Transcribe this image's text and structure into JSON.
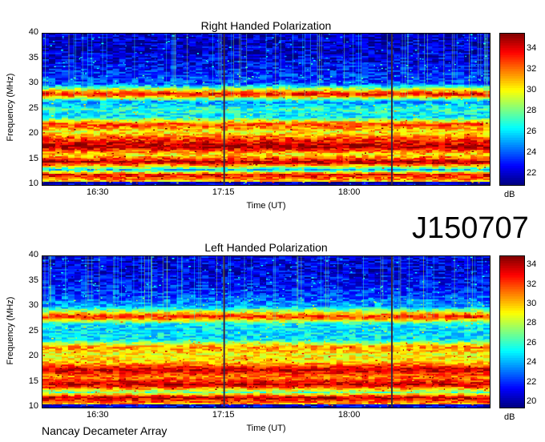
{
  "identifier": "J150707",
  "credit": "Nancay Decameter Array",
  "panels": [
    {
      "title": "Right Handed Polarization",
      "xlabel": "Time (UT)",
      "ylabel": "Frequency (MHz)",
      "yticks": [
        "10",
        "15",
        "20",
        "25",
        "30",
        "35",
        "40"
      ],
      "xticks": [
        "16:30",
        "17:15",
        "18:00"
      ],
      "colorbar_ticks": [
        "22",
        "24",
        "26",
        "28",
        "30",
        "32",
        "34"
      ],
      "colorbar_unit": "dB"
    },
    {
      "title": "Left Handed Polarization",
      "xlabel": "Time (UT)",
      "ylabel": "Frequency (MHz)",
      "yticks": [
        "10",
        "15",
        "20",
        "25",
        "30",
        "35",
        "40"
      ],
      "xticks": [
        "16:30",
        "17:15",
        "18:00"
      ],
      "colorbar_ticks": [
        "20",
        "22",
        "24",
        "26",
        "28",
        "30",
        "32",
        "34"
      ],
      "colorbar_unit": "dB"
    }
  ],
  "chart_data": [
    {
      "type": "heatmap",
      "title": "Right Handed Polarization",
      "xlabel": "Time (UT)",
      "ylabel": "Frequency (MHz)",
      "ylim": [
        10,
        40
      ],
      "xlim": [
        "16:10",
        "18:50"
      ],
      "xticks": [
        "16:30",
        "17:15",
        "18:00"
      ],
      "yticks": [
        10,
        15,
        20,
        25,
        30,
        35,
        40
      ],
      "colorbar": {
        "unit": "dB",
        "range": [
          21,
          35.5
        ],
        "ticks": [
          22,
          24,
          26,
          28,
          30,
          32,
          34
        ],
        "colormap": "jet"
      },
      "intensity_profile_by_frequency": [
        {
          "freq_mhz": 10.5,
          "db": 30
        },
        {
          "freq_mhz": 12,
          "db": 34
        },
        {
          "freq_mhz": 13,
          "db": 26
        },
        {
          "freq_mhz": 14.5,
          "db": 35
        },
        {
          "freq_mhz": 16,
          "db": 30
        },
        {
          "freq_mhz": 17.5,
          "db": 35
        },
        {
          "freq_mhz": 19,
          "db": 33
        },
        {
          "freq_mhz": 20.5,
          "db": 30
        },
        {
          "freq_mhz": 22,
          "db": 33
        },
        {
          "freq_mhz": 23.5,
          "db": 26
        },
        {
          "freq_mhz": 25,
          "db": 27
        },
        {
          "freq_mhz": 26.5,
          "db": 25
        },
        {
          "freq_mhz": 28,
          "db": 34
        },
        {
          "freq_mhz": 30,
          "db": 24
        },
        {
          "freq_mhz": 33,
          "db": 23
        },
        {
          "freq_mhz": 37,
          "db": 22
        },
        {
          "freq_mhz": 40,
          "db": 22
        }
      ],
      "vertical_lines_ut": [
        "17:15",
        "18:15"
      ]
    },
    {
      "type": "heatmap",
      "title": "Left Handed Polarization",
      "xlabel": "Time (UT)",
      "ylabel": "Frequency (MHz)",
      "ylim": [
        10,
        40
      ],
      "xlim": [
        "16:10",
        "18:50"
      ],
      "xticks": [
        "16:30",
        "17:15",
        "18:00"
      ],
      "yticks": [
        10,
        15,
        20,
        25,
        30,
        35,
        40
      ],
      "colorbar": {
        "unit": "dB",
        "range": [
          19.5,
          35
        ],
        "ticks": [
          20,
          22,
          24,
          26,
          28,
          30,
          32,
          34
        ],
        "colormap": "jet"
      },
      "intensity_profile_by_frequency": [
        {
          "freq_mhz": 10.5,
          "db": 30
        },
        {
          "freq_mhz": 12,
          "db": 34
        },
        {
          "freq_mhz": 13,
          "db": 27
        },
        {
          "freq_mhz": 14.5,
          "db": 34
        },
        {
          "freq_mhz": 16,
          "db": 31
        },
        {
          "freq_mhz": 17.5,
          "db": 34
        },
        {
          "freq_mhz": 19,
          "db": 30
        },
        {
          "freq_mhz": 20.5,
          "db": 29
        },
        {
          "freq_mhz": 22,
          "db": 31
        },
        {
          "freq_mhz": 23.5,
          "db": 25
        },
        {
          "freq_mhz": 25,
          "db": 25
        },
        {
          "freq_mhz": 26.5,
          "db": 25
        },
        {
          "freq_mhz": 28,
          "db": 33
        },
        {
          "freq_mhz": 30,
          "db": 24
        },
        {
          "freq_mhz": 33,
          "db": 22
        },
        {
          "freq_mhz": 37,
          "db": 21
        },
        {
          "freq_mhz": 40,
          "db": 21
        }
      ],
      "vertical_lines_ut": [
        "17:15",
        "18:15"
      ]
    }
  ]
}
